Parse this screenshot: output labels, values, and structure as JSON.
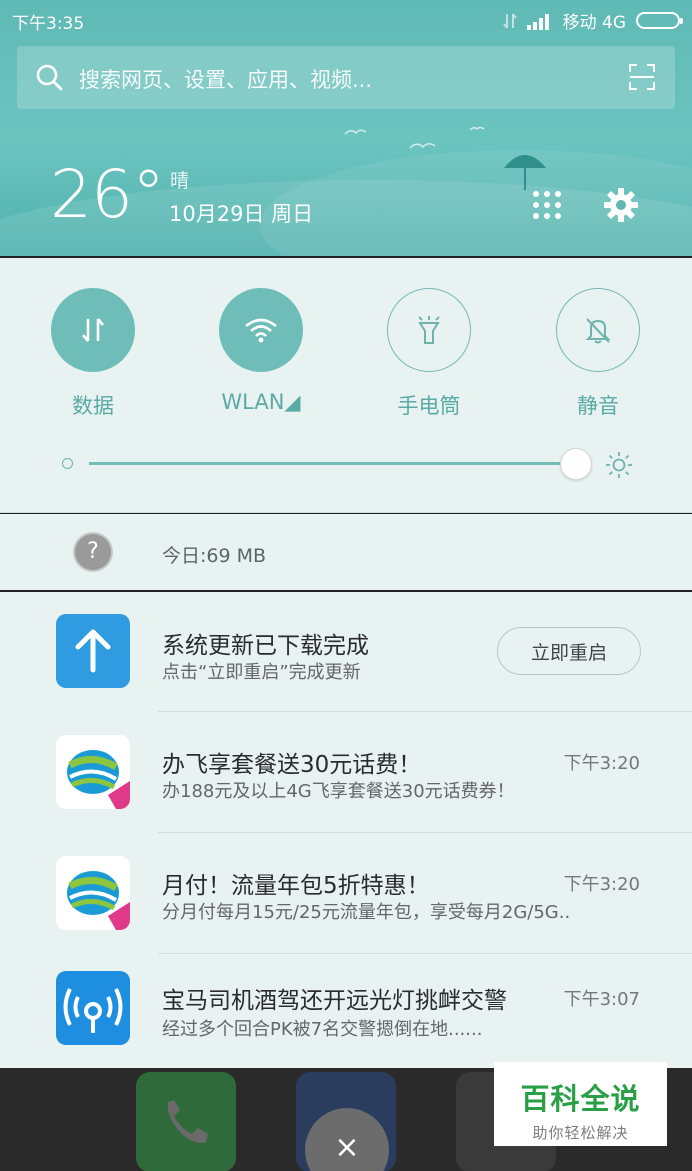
{
  "status_bar": {
    "time": "下午3:35",
    "carrier": "移动 4G"
  },
  "search": {
    "placeholder": "搜索网页、设置、应用、视频..."
  },
  "weather": {
    "temperature": "26°",
    "condition": "晴",
    "date": "10月29日 周日"
  },
  "quick_toggles": [
    {
      "label": "数据",
      "icon": "data-arrows-icon",
      "active": true
    },
    {
      "label": "WLAN◢",
      "icon": "wifi-icon",
      "active": true
    },
    {
      "label": "手电筒",
      "icon": "flashlight-icon",
      "active": false
    },
    {
      "label": "静音",
      "icon": "bell-mute-icon",
      "active": false
    }
  ],
  "brightness": {
    "level_fraction": 0.97
  },
  "data_usage": {
    "text": "今日:69 MB"
  },
  "notifications": [
    {
      "app": "system-update",
      "title": "系统更新已下载完成",
      "body": "点击“立即重启”完成更新",
      "action": "立即重启",
      "time": ""
    },
    {
      "app": "china-mobile",
      "title": "办飞享套餐送30元话费！",
      "body": "办188元及以上4G飞享套餐送30元话费券！",
      "time": "下午3:20"
    },
    {
      "app": "china-mobile",
      "title": "月付！流量年包5折特惠！",
      "body": "分月付每月15元/25元流量年包，享受每月2G/5G..",
      "time": "下午3:20"
    },
    {
      "app": "wifi-key",
      "title": "宝马司机酒驾还开远光灯挑衅交警",
      "body": "经过多个回合PK被7名交警摁倒在地......",
      "time": "下午3:07"
    }
  ],
  "colors": {
    "accent": "#6fbdb8",
    "header": "#5fb9b5",
    "panel": "#e8f3f1",
    "update_blue": "#2f9be0"
  },
  "watermark": {
    "title": "百科全说",
    "subtitle": "助你轻松解决"
  },
  "close_label": "×"
}
